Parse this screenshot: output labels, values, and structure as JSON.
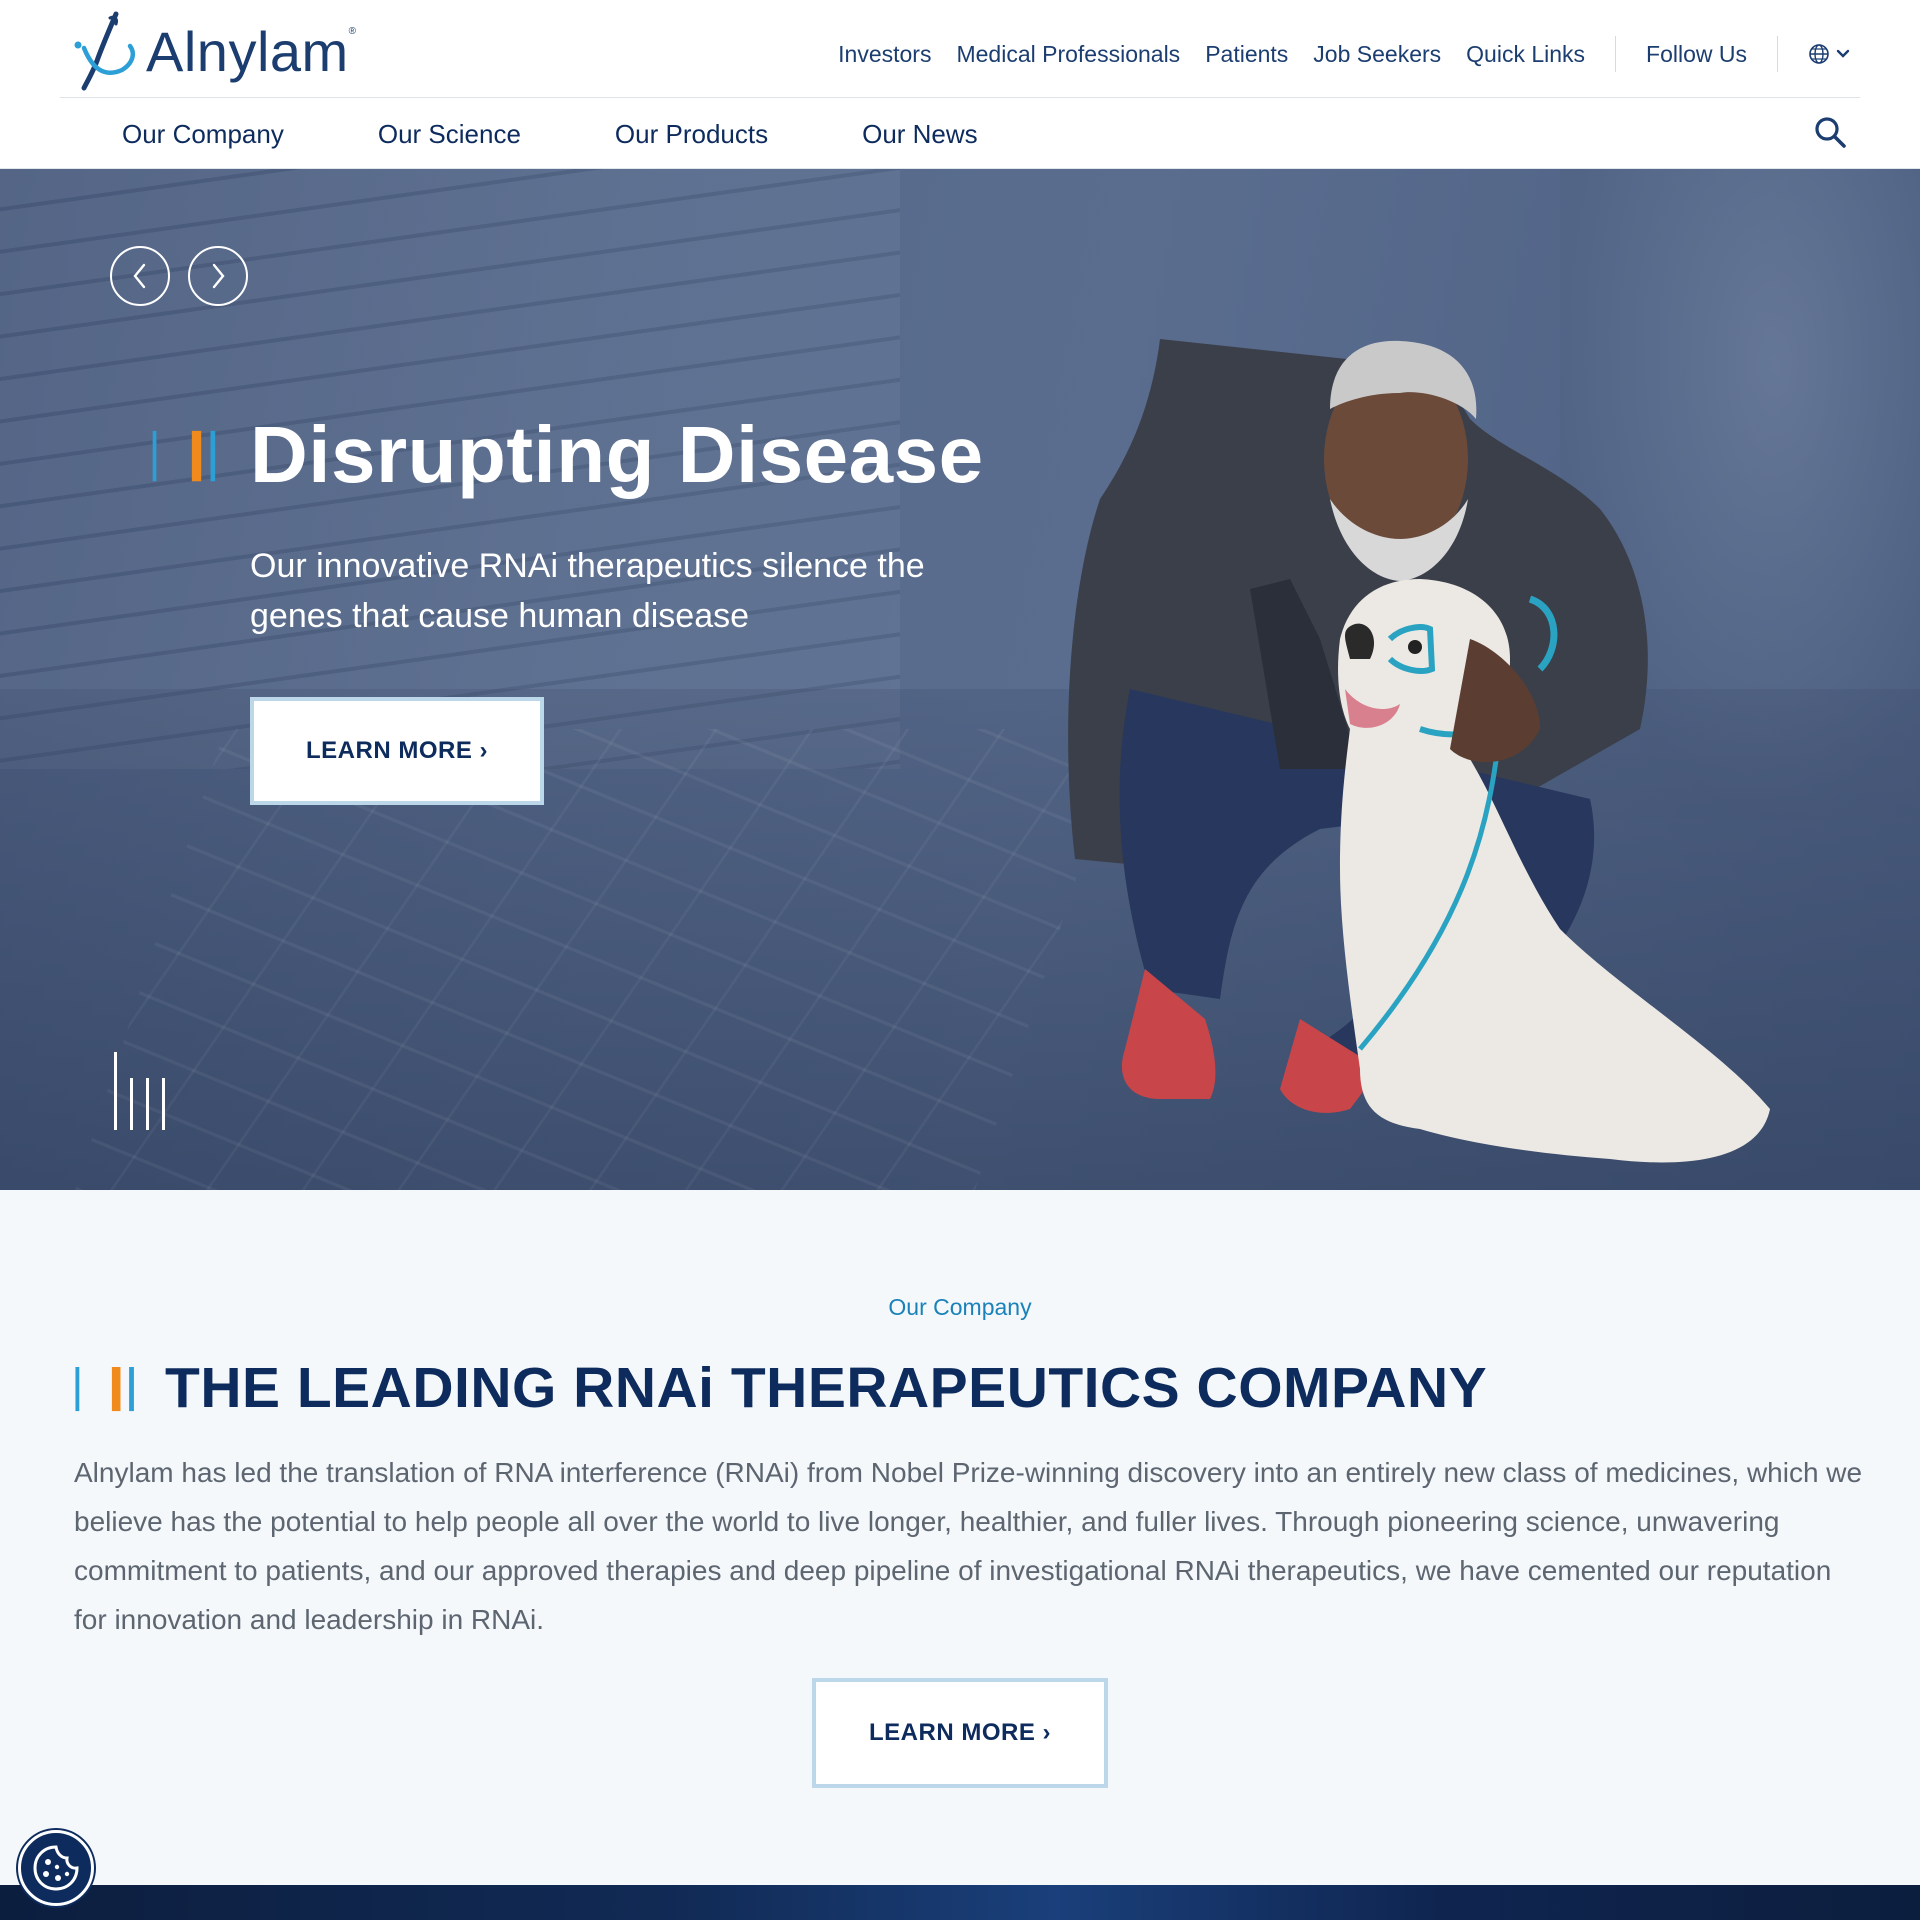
{
  "brand": {
    "name": "Alnylam",
    "colors": {
      "navy": "#0d2b5c",
      "blue_accent": "#1a82b8",
      "orange_accent": "#f08a1c",
      "link": "#1b3d70"
    }
  },
  "utility_nav": {
    "items": [
      "Investors",
      "Medical Professionals",
      "Patients",
      "Job Seekers",
      "Quick Links"
    ],
    "follow_us": "Follow Us",
    "language_icon": "globe-icon"
  },
  "main_nav": {
    "items": [
      "Our Company",
      "Our Science",
      "Our Products",
      "Our News"
    ],
    "search_icon": "search-icon"
  },
  "hero": {
    "title": "Disrupting Disease",
    "subtitle": "Our innovative RNAi therapeutics silence the genes that cause human disease",
    "cta": "LEARN MORE ›",
    "prev_icon": "chevron-left-icon",
    "next_icon": "chevron-right-icon"
  },
  "company": {
    "eyebrow": "Our Company",
    "title": "THE LEADING RNAi THERAPEUTICS COMPANY",
    "body": "Alnylam has led the translation of RNA interference (RNAi) from Nobel Prize-winning discovery into an entirely new class of medicines, which we believe has the potential to help people all over the world to live longer, healthier, and fuller lives. Through pioneering science, unwavering commitment to patients, and our approved therapies and deep pipeline of investigational RNAi therapeutics, we have cemented our reputation for innovation and leadership in RNAi.",
    "cta": "LEARN MORE ›"
  },
  "cookie": {
    "icon": "cookie-icon"
  }
}
